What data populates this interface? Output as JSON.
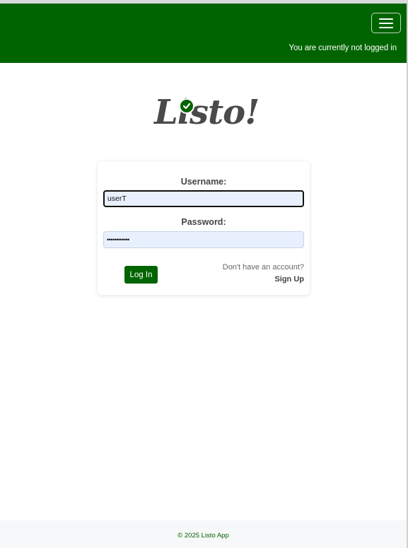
{
  "header": {
    "menu_icon": "hamburger-menu-icon",
    "status_text": "You are currently not logged in",
    "background_color": "#006400"
  },
  "logo": {
    "text": "Listo!",
    "check_icon": "checkmark-circle-icon"
  },
  "login_form": {
    "username_label": "Username:",
    "username_value": "userT",
    "password_label": "Password:",
    "password_value": "••••••••••••",
    "login_button": "Log In",
    "signup_prompt": "Don't have an account?",
    "signup_link": "Sign Up"
  },
  "footer": {
    "text": "© 2025 Listo App"
  },
  "colors": {
    "brand_green": "#006400",
    "input_background": "#e8f0fe"
  }
}
